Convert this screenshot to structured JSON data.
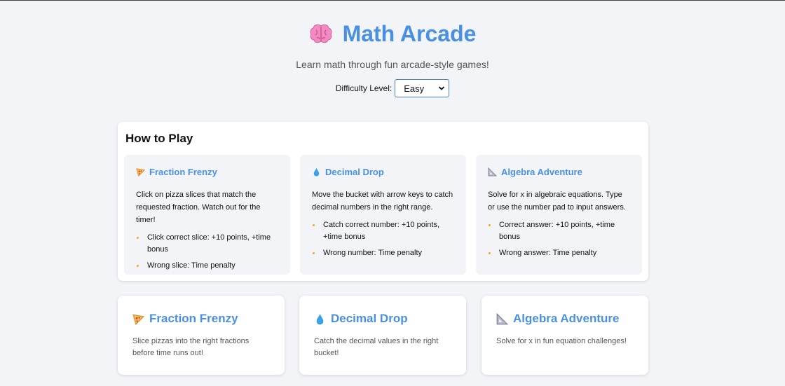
{
  "header": {
    "title": "Math Arcade",
    "subtitle": "Learn math through fun arcade-style games!",
    "difficulty_label": "Difficulty Level:",
    "difficulty_value": "Easy"
  },
  "how_to_play": {
    "heading": "How to Play",
    "games": [
      {
        "icon": "pizza-icon",
        "title": "Fraction Frenzy",
        "description": "Click on pizza slices that match the requested fraction. Watch out for the timer!",
        "rules": [
          "Click correct slice: +10 points, +time bonus",
          "Wrong slice: Time penalty"
        ]
      },
      {
        "icon": "droplet-icon",
        "title": "Decimal Drop",
        "description": "Move the bucket with arrow keys to catch decimal numbers in the right range.",
        "rules": [
          "Catch correct number: +10 points, +time bonus",
          "Wrong number: Time penalty"
        ]
      },
      {
        "icon": "triangle-ruler-icon",
        "title": "Algebra Adventure",
        "description": "Solve for x in algebraic equations. Type or use the number pad to input answers.",
        "rules": [
          "Correct answer: +10 points, +time bonus",
          "Wrong answer: Time penalty"
        ]
      }
    ]
  },
  "game_cards": [
    {
      "icon": "pizza-icon",
      "title": "Fraction Frenzy",
      "description": "Slice pizzas into the right fractions before time runs out!"
    },
    {
      "icon": "droplet-icon",
      "title": "Decimal Drop",
      "description": "Catch the decimal values in the right bucket!"
    },
    {
      "icon": "triangle-ruler-icon",
      "title": "Algebra Adventure",
      "description": "Solve for x in fun equation challenges!"
    }
  ],
  "colors": {
    "accent": "#4a90e2",
    "bullet": "#f5a623",
    "background": "#f3f4f8"
  }
}
